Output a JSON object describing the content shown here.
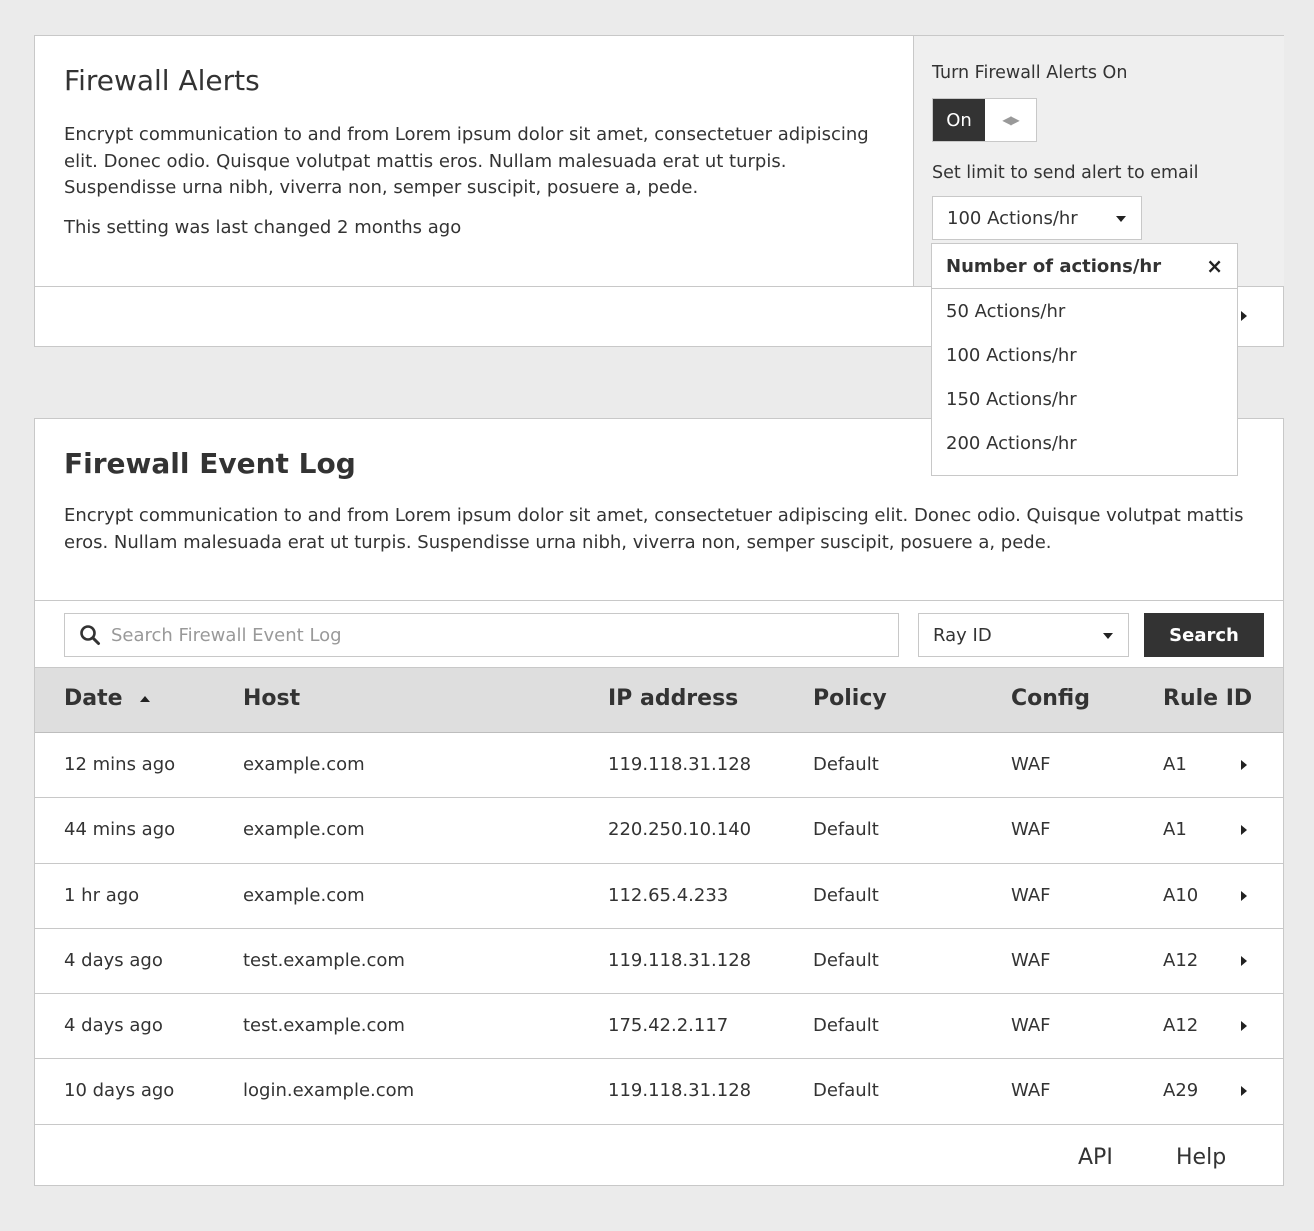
{
  "alerts": {
    "title": "Firewall Alerts",
    "description": "Encrypt communication to and from Lorem ipsum dolor sit amet, consectetuer adipiscing elit. Donec odio. Quisque volutpat mattis eros. Nullam malesuada erat ut turpis. Suspendisse urna nibh, viverra non, semper suscipit, posuere a, pede.",
    "last_changed": "This setting was last changed 2 months ago",
    "toggle_label": "Turn Firewall Alerts On",
    "toggle_on_label": "On",
    "toggle_off_glyph": "◀▶",
    "limit_label": "Set limit to send alert to email",
    "limit_value": "100 Actions/hr"
  },
  "limit_dropdown": {
    "header": "Number of actions/hr",
    "close_glyph": "×",
    "options": [
      "50 Actions/hr",
      "100 Actions/hr",
      "150 Actions/hr",
      "200 Actions/hr"
    ]
  },
  "event_log": {
    "title": "Firewall Event Log",
    "description": "Encrypt communication to and from Lorem ipsum dolor sit amet, consectetuer adipiscing  elit. Donec odio. Quisque volutpat mattis eros. Nullam malesuada erat ut turpis. Suspendisse urna nibh, viverra non, semper suscipit, posuere a, pede.",
    "search_placeholder": "Search Firewall Event Log",
    "search_field": "Ray ID",
    "search_button": "Search",
    "columns": [
      "Date",
      "Host",
      "IP address",
      "Policy",
      "Config",
      "Rule ID"
    ],
    "sort_column": "Date",
    "sort_direction": "ascending",
    "rows": [
      {
        "date": "12 mins ago",
        "host": "example.com",
        "ip": "119.118.31.128",
        "policy": "Default",
        "config": "WAF",
        "rule": "A1"
      },
      {
        "date": "44 mins ago",
        "host": "example.com",
        "ip": "220.250.10.140",
        "policy": "Default",
        "config": "WAF",
        "rule": "A1"
      },
      {
        "date": "1 hr ago",
        "host": "example.com",
        "ip": "112.65.4.233",
        "policy": "Default",
        "config": "WAF",
        "rule": "A10"
      },
      {
        "date": "4 days ago",
        "host": "test.example.com",
        "ip": "119.118.31.128",
        "policy": "Default",
        "config": "WAF",
        "rule": "A12"
      },
      {
        "date": "4 days ago",
        "host": "test.example.com",
        "ip": "175.42.2.117",
        "policy": "Default",
        "config": "WAF",
        "rule": "A12"
      },
      {
        "date": "10 days ago",
        "host": "login.example.com",
        "ip": "119.118.31.128",
        "policy": "Default",
        "config": "WAF",
        "rule": "A29"
      }
    ],
    "footer_links": [
      "API",
      "Help"
    ]
  },
  "colors": {
    "page_bg": "#ebebeb",
    "card_bg": "#ffffff",
    "border": "#c8c8c8",
    "dark_accent": "#333333",
    "table_header_bg": "#dedede"
  }
}
